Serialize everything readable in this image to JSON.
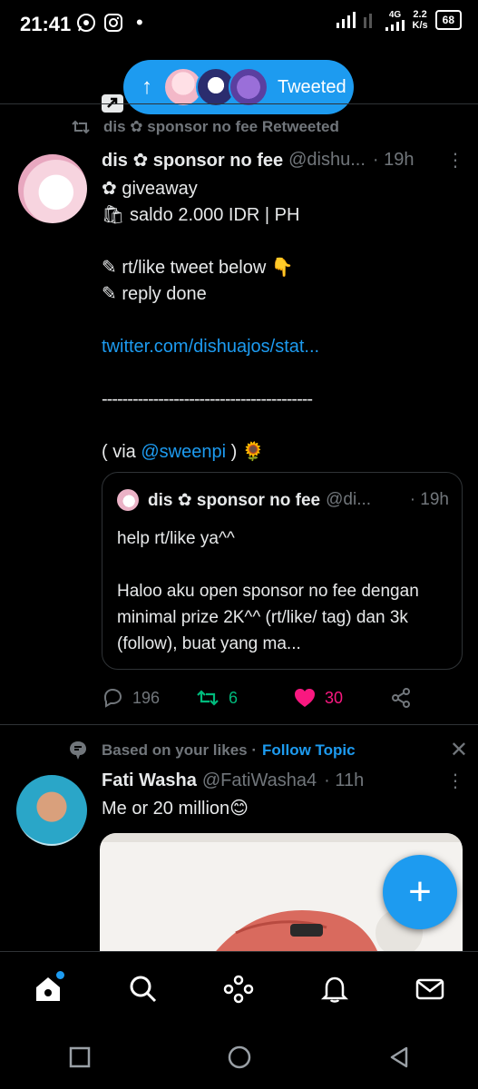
{
  "status_bar": {
    "time": "21:41",
    "net_speed_value": "2.2",
    "net_speed_unit": "K/s",
    "network_label": "4G",
    "battery": "68"
  },
  "new_tweets_pill": {
    "label": "Tweeted"
  },
  "retweet_context": {
    "label": "dis ✿ sponsor no fee Retweeted"
  },
  "tweet": {
    "name": "dis ✿ sponsor no fee",
    "handle": "@dishu...",
    "time": "· 19h",
    "lines": [
      "✿ giveaway",
      "🛍 saldo 2.000 IDR | PH",
      "",
      "✎ rt/like tweet below 👇",
      "✎ reply done",
      ""
    ],
    "link": "twitter.com/dishuajos/stat...",
    "separator": "-----------------------------------------",
    "via_prefix": "( via ",
    "via_mention": "@sweenpi",
    "via_suffix": " ) 🌻",
    "quote": {
      "name": "dis ✿ sponsor no fee",
      "handle": "@di...",
      "time": "· 19h",
      "line1": "help rt/like ya^^",
      "line2": "Haloo aku open sponsor no fee dengan minimal prize 2K^^ (rt/like/ tag) dan 3k (follow), buat yang ma..."
    },
    "actions": {
      "replies": "196",
      "retweets": "6",
      "likes": "30"
    },
    "colors": {
      "retweet": "#00ba7c",
      "like": "#f91880",
      "link": "#1d9bf0"
    }
  },
  "topic": {
    "label": "Based on your likes ·",
    "follow_label": "Follow Topic"
  },
  "tweet2": {
    "name": "Fati Washa",
    "handle": "@FatiWasha4",
    "time": "· 11h",
    "text": "Me or 20 million😊"
  },
  "fab": {
    "label": "+"
  },
  "nav": {
    "items": [
      "home-icon",
      "search-icon",
      "spaces-icon",
      "notifications-icon",
      "messages-icon"
    ]
  }
}
